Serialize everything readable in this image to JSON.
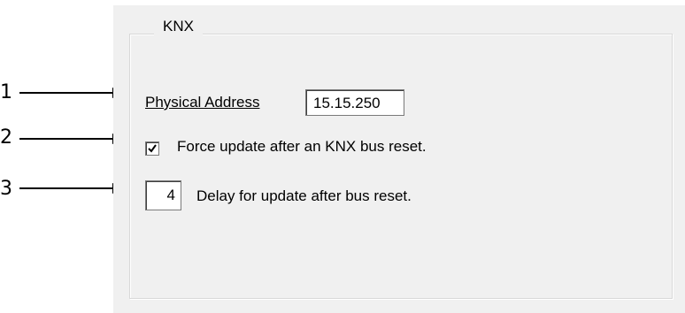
{
  "group": {
    "title": "KNX"
  },
  "physical_address": {
    "label": "Physical Address",
    "value": "15.15.250"
  },
  "force_update": {
    "label": "Force update after an KNX bus reset.",
    "checked": true
  },
  "delay": {
    "value": "4",
    "label": "Delay for update after bus reset."
  },
  "callouts": [
    "1",
    "2",
    "3"
  ]
}
